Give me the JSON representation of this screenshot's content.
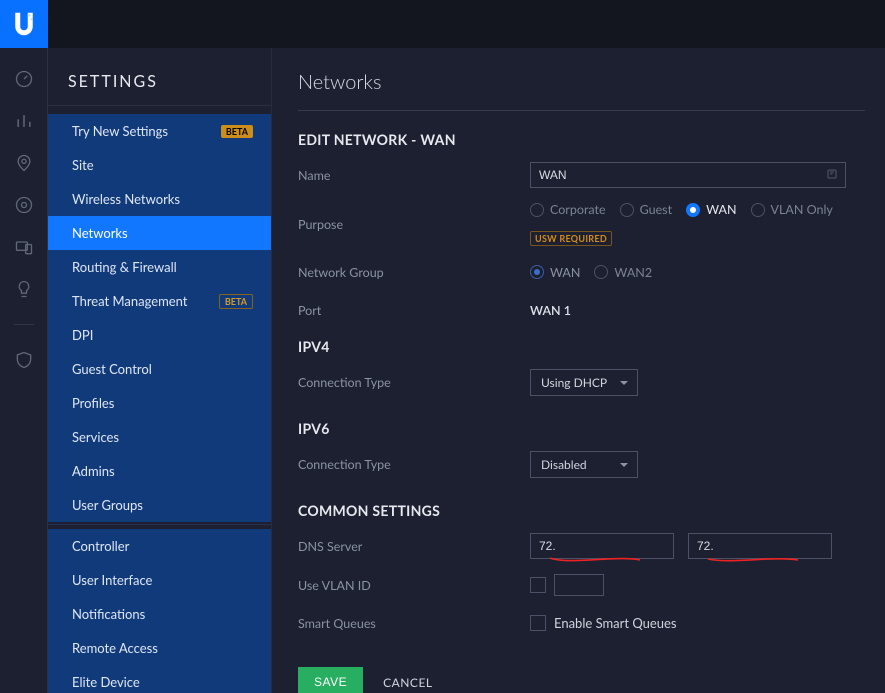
{
  "topbar": {
    "logo_letter": "U"
  },
  "settings_title": "SETTINGS",
  "nav": {
    "group1": [
      {
        "label": "Try New Settings",
        "badge": "BETA",
        "badge_style": "y"
      },
      {
        "label": "Site"
      },
      {
        "label": "Wireless Networks"
      },
      {
        "label": "Networks",
        "active": true
      },
      {
        "label": "Routing & Firewall"
      },
      {
        "label": "Threat Management",
        "badge": "BETA",
        "badge_style": "d"
      },
      {
        "label": "DPI"
      },
      {
        "label": "Guest Control"
      },
      {
        "label": "Profiles"
      },
      {
        "label": "Services"
      },
      {
        "label": "Admins"
      },
      {
        "label": "User Groups"
      }
    ],
    "group2": [
      {
        "label": "Controller"
      },
      {
        "label": "User Interface"
      },
      {
        "label": "Notifications"
      },
      {
        "label": "Remote Access"
      },
      {
        "label": "Elite Device"
      }
    ]
  },
  "page": {
    "title": "Networks",
    "edit_heading": "EDIT NETWORK - WAN",
    "name_label": "Name",
    "name_value": "WAN",
    "purpose_label": "Purpose",
    "purpose_options": {
      "corporate": "Corporate",
      "guest": "Guest",
      "wan": "WAN",
      "vlan_only": "VLAN Only"
    },
    "usw_required": "USW REQUIRED",
    "network_group_label": "Network Group",
    "network_group_options": {
      "wan": "WAN",
      "wan2": "WAN2"
    },
    "port_label": "Port",
    "port_value": "WAN 1",
    "ipv4_heading": "IPV4",
    "conn_type_label": "Connection Type",
    "ipv4_conn_value": "Using DHCP",
    "ipv6_heading": "IPV6",
    "ipv6_conn_value": "Disabled",
    "common_heading": "COMMON SETTINGS",
    "dns_label": "DNS Server",
    "dns1": "72.",
    "dns2": "72.",
    "vlan_label": "Use VLAN ID",
    "smart_q_label": "Smart Queues",
    "smart_q_option": "Enable Smart Queues",
    "save": "SAVE",
    "cancel": "CANCEL"
  }
}
